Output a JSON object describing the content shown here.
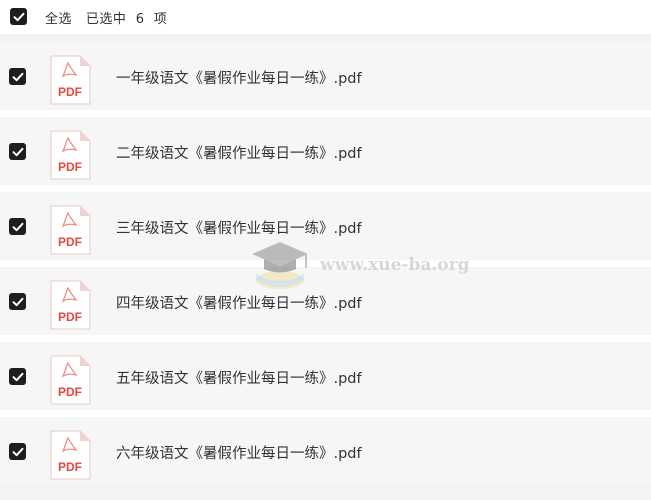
{
  "header": {
    "select_all_label": "全选",
    "selected_prefix": "已选中",
    "selected_count": "6",
    "selected_suffix": "项"
  },
  "files": [
    {
      "name": "一年级语文《暑假作业每日一练》.pdf",
      "icon_label": "PDF",
      "checked": true
    },
    {
      "name": "二年级语文《暑假作业每日一练》.pdf",
      "icon_label": "PDF",
      "checked": true
    },
    {
      "name": "三年级语文《暑假作业每日一练》.pdf",
      "icon_label": "PDF",
      "checked": true
    },
    {
      "name": "四年级语文《暑假作业每日一练》.pdf",
      "icon_label": "PDF",
      "checked": true
    },
    {
      "name": "五年级语文《暑假作业每日一练》.pdf",
      "icon_label": "PDF",
      "checked": true
    },
    {
      "name": "六年级语文《暑假作业每日一练》.pdf",
      "icon_label": "PDF",
      "checked": true
    }
  ],
  "watermark": {
    "text": "www.xue-ba.org"
  },
  "colors": {
    "checkbox": "#1e1e1e",
    "pdf_red": "#e8463f",
    "row_bg": "#f6f6f6"
  }
}
